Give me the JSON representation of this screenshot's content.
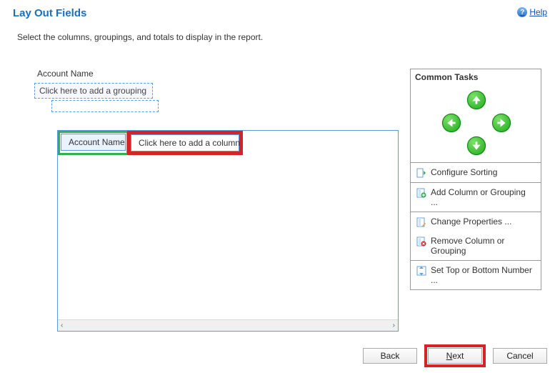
{
  "header": {
    "title": "Lay Out Fields",
    "help_label": "Help"
  },
  "instruction": "Select the columns, groupings, and totals to display in the report.",
  "grouping": {
    "field_label": "Account Name",
    "placeholder": "Click here to add a grouping"
  },
  "columns": {
    "col1": "Account Name",
    "add_placeholder": "Click here to add a column"
  },
  "tasks": {
    "panel_title": "Common Tasks",
    "configure_sorting": "Configure Sorting",
    "add_column": "Add Column or Grouping ...",
    "change_properties": "Change Properties ...",
    "remove_column": "Remove Column or Grouping",
    "set_top_bottom": "Set Top or Bottom Number ..."
  },
  "footer": {
    "back": "Back",
    "next": "ext",
    "next_mnemonic": "N",
    "cancel": "Cancel"
  }
}
